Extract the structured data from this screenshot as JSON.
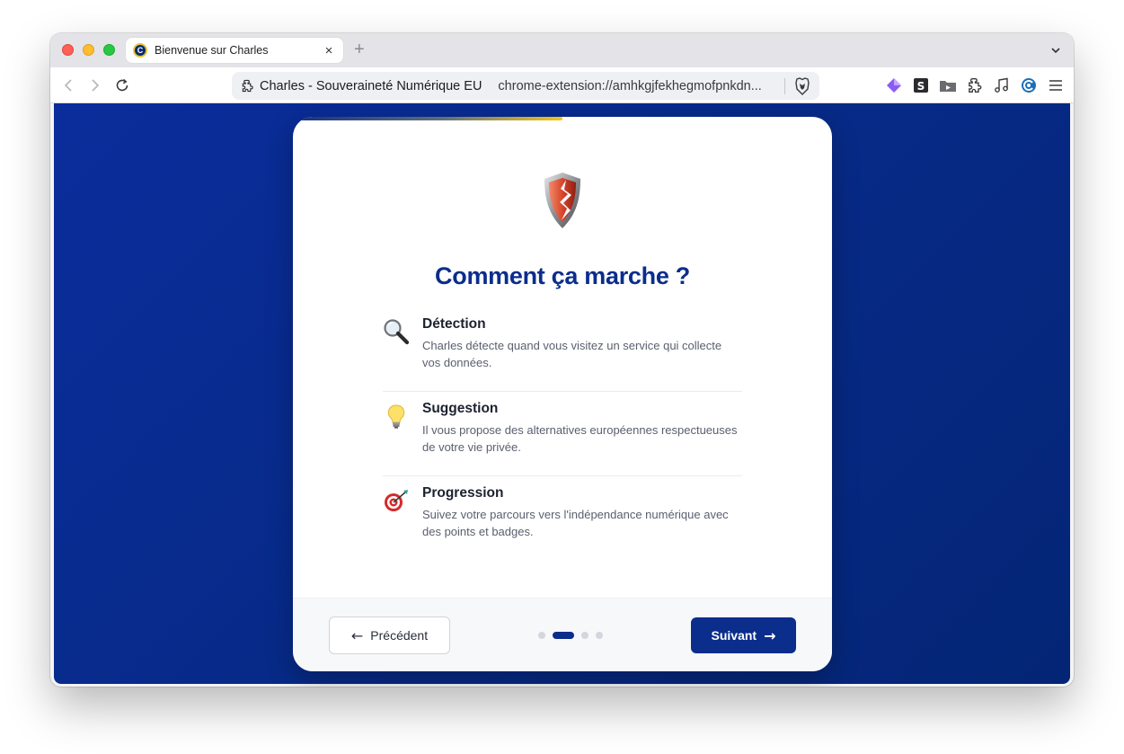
{
  "browser": {
    "tab_title": "Bienvenue sur Charles",
    "tab_close": "×",
    "new_tab": "+",
    "url_site": "Charles - Souveraineté Numérique EU",
    "url_path": "chrome-extension://amhkgjfekhegmofpnkdn..."
  },
  "onboarding": {
    "title": "Comment ça marche ?",
    "progress_fraction": 0.5,
    "steps": [
      {
        "title": "Détection",
        "description": "Charles détecte quand vous visitez un service qui collecte vos données.",
        "icon": "magnifying-glass-icon"
      },
      {
        "title": "Suggestion",
        "description": "Il vous propose des alternatives européennes respectueuses de votre vie privée.",
        "icon": "light-bulb-icon"
      },
      {
        "title": "Progression",
        "description": "Suivez votre parcours vers l'indépendance numérique avec des points et badges.",
        "icon": "target-icon"
      }
    ],
    "prev_label": "Précédent",
    "prev_arrow": "←",
    "next_label": "Suivant",
    "next_arrow": "→",
    "dots_total": 4,
    "dots_active": 2
  },
  "colors": {
    "brand_blue": "#0b2d8c",
    "accent_yellow": "#f5c617",
    "page_background": "#072a88"
  }
}
